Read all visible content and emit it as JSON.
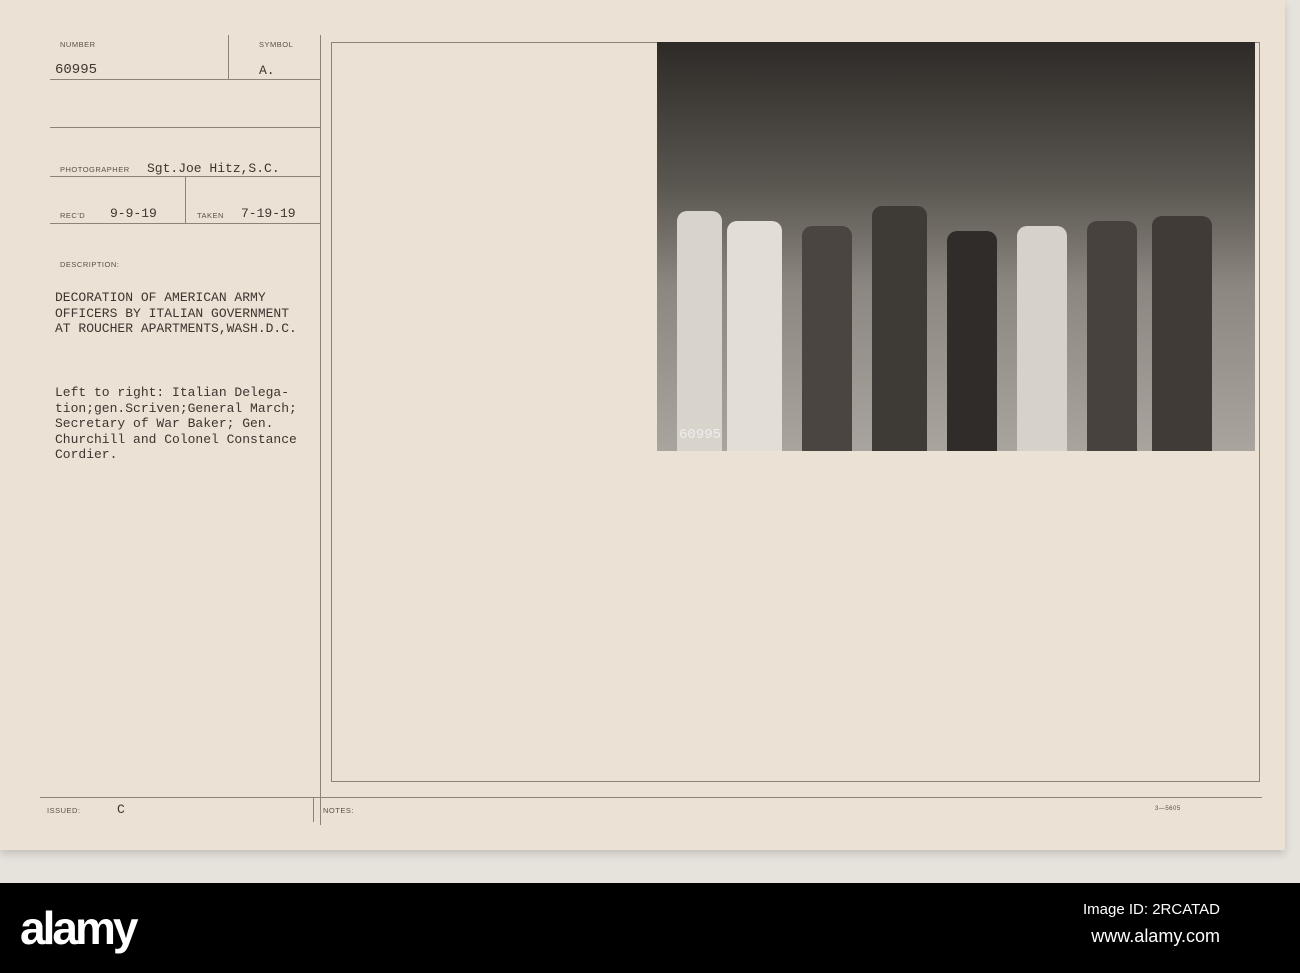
{
  "card": {
    "number_label": "NUMBER",
    "number": "60995",
    "symbol_label": "SYMBOL",
    "symbol": "A.",
    "photographer_label": "PHOTOGRAPHER",
    "photographer": "Sgt.Joe Hitz,S.C.",
    "recd_label": "REC'D",
    "recd": "9-9-19",
    "taken_label": "TAKEN",
    "taken": "7-19-19",
    "description_label": "DESCRIPTION:",
    "description": "DECORATION OF AMERICAN ARMY\nOFFICERS BY ITALIAN GOVERNMENT\nAT ROUCHER APARTMENTS,WASH.D.C.",
    "caption": "Left to right: Italian Delega-\ntion;gen.Scriven;General March;\nSecretary of War Baker; Gen.\nChurchill and Colonel Constance\nCordier.",
    "issued_label": "ISSUED:",
    "issued": "C",
    "notes_label": "NOTES:",
    "form_code": "3—5605",
    "photo_number": "60995"
  },
  "watermark": {
    "logo": "alamy",
    "image_id": "Image ID: 2RCATAD",
    "url": "www.alamy.com"
  }
}
